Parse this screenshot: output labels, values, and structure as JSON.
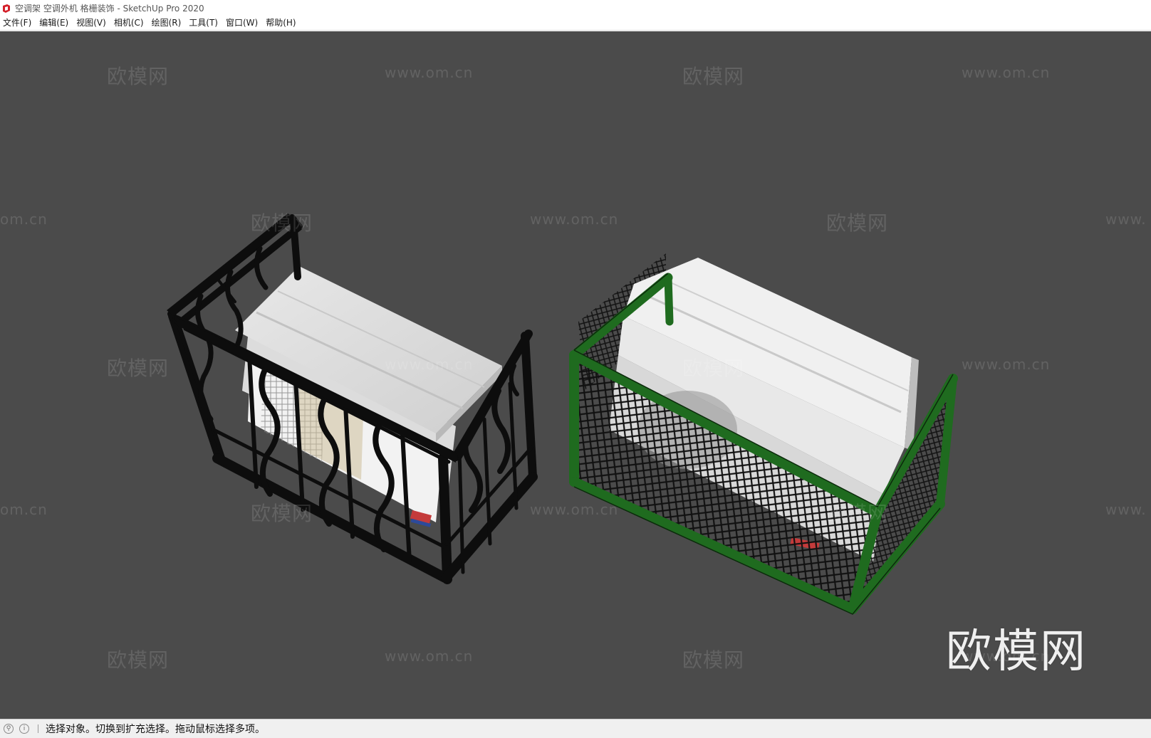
{
  "window": {
    "title": "空调架 空调外机 格栅装饰 - SketchUp Pro 2020",
    "icon": "sketchup-logo-icon",
    "icon_color": "#d4202a"
  },
  "menubar": {
    "items": [
      {
        "label": "文件(F)"
      },
      {
        "label": "编辑(E)"
      },
      {
        "label": "视图(V)"
      },
      {
        "label": "相机(C)"
      },
      {
        "label": "绘图(R)"
      },
      {
        "label": "工具(T)"
      },
      {
        "label": "窗口(W)"
      },
      {
        "label": "帮助(H)"
      }
    ]
  },
  "viewport": {
    "background": "#4b4b4b",
    "models": [
      {
        "name": "black-wrought-iron-ac-cage",
        "frame_color": "#0d0d0d"
      },
      {
        "name": "green-mesh-ac-cage",
        "frame_color": "#1f6b1f"
      }
    ],
    "watermarks": {
      "cn": "欧模网",
      "url": "www.om.cn",
      "url_cut_left": "om.cn",
      "url_cut_right": "www."
    },
    "big_watermark": "欧模网"
  },
  "statusbar": {
    "icons": [
      "geo-location-icon",
      "info-icon"
    ],
    "message": "选择对象。切换到扩充选择。拖动鼠标选择多项。"
  }
}
